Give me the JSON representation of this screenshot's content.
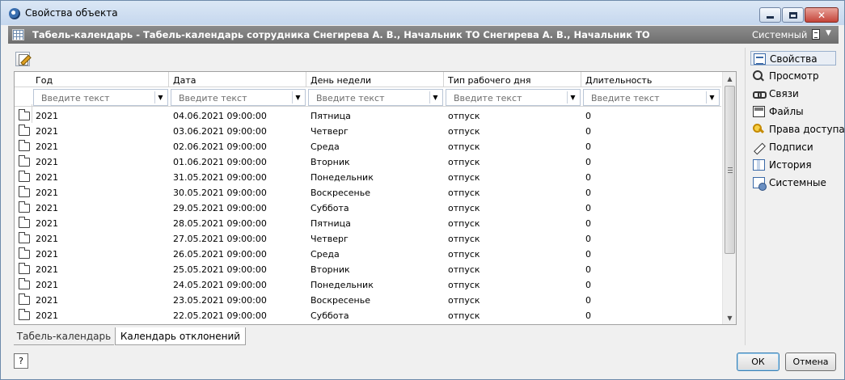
{
  "window": {
    "title": "Свойства объекта",
    "minimize_glyph": "",
    "close_glyph": "✕"
  },
  "object_bar": {
    "title": "Табель-календарь - Табель-календарь сотрудника Снегирева А. В., Начальник ТО Снегирева А. В., Начальник ТО",
    "system_label": "Системный",
    "dropdown_glyph": "▼"
  },
  "grid": {
    "columns": [
      "Год",
      "Дата",
      "День недели",
      "Тип рабочего дня",
      "Длительность"
    ],
    "filter_placeholder": "Введите текст",
    "rows": [
      {
        "year": "2021",
        "date": "04.06.2021 09:00:00",
        "weekday": "Пятница",
        "type": "отпуск",
        "duration": "0"
      },
      {
        "year": "2021",
        "date": "03.06.2021 09:00:00",
        "weekday": "Четверг",
        "type": "отпуск",
        "duration": "0"
      },
      {
        "year": "2021",
        "date": "02.06.2021 09:00:00",
        "weekday": "Среда",
        "type": "отпуск",
        "duration": "0"
      },
      {
        "year": "2021",
        "date": "01.06.2021 09:00:00",
        "weekday": "Вторник",
        "type": "отпуск",
        "duration": "0"
      },
      {
        "year": "2021",
        "date": "31.05.2021 09:00:00",
        "weekday": "Понедельник",
        "type": "отпуск",
        "duration": "0"
      },
      {
        "year": "2021",
        "date": "30.05.2021 09:00:00",
        "weekday": "Воскресенье",
        "type": "отпуск",
        "duration": "0"
      },
      {
        "year": "2021",
        "date": "29.05.2021 09:00:00",
        "weekday": "Суббота",
        "type": "отпуск",
        "duration": "0"
      },
      {
        "year": "2021",
        "date": "28.05.2021 09:00:00",
        "weekday": "Пятница",
        "type": "отпуск",
        "duration": "0"
      },
      {
        "year": "2021",
        "date": "27.05.2021 09:00:00",
        "weekday": "Четверг",
        "type": "отпуск",
        "duration": "0"
      },
      {
        "year": "2021",
        "date": "26.05.2021 09:00:00",
        "weekday": "Среда",
        "type": "отпуск",
        "duration": "0"
      },
      {
        "year": "2021",
        "date": "25.05.2021 09:00:00",
        "weekday": "Вторник",
        "type": "отпуск",
        "duration": "0"
      },
      {
        "year": "2021",
        "date": "24.05.2021 09:00:00",
        "weekday": "Понедельник",
        "type": "отпуск",
        "duration": "0"
      },
      {
        "year": "2021",
        "date": "23.05.2021 09:00:00",
        "weekday": "Воскресенье",
        "type": "отпуск",
        "duration": "0"
      },
      {
        "year": "2021",
        "date": "22.05.2021 09:00:00",
        "weekday": "Суббота",
        "type": "отпуск",
        "duration": "0"
      }
    ]
  },
  "tabs": [
    "Табель-календарь",
    "Календарь отклонений"
  ],
  "active_tab": 1,
  "side_panel": {
    "items": [
      {
        "label": "Свойства",
        "icon": "properties-icon",
        "active": true
      },
      {
        "label": "Просмотр",
        "icon": "magnifier-icon"
      },
      {
        "label": "Связи",
        "icon": "chain-link-icon"
      },
      {
        "label": "Файлы",
        "icon": "floppy-disk-icon"
      },
      {
        "label": "Права доступа",
        "icon": "key-icon"
      },
      {
        "label": "Подписи",
        "icon": "pen-icon"
      },
      {
        "label": "История",
        "icon": "history-icon"
      },
      {
        "label": "Системные",
        "icon": "system-gear-icon"
      }
    ]
  },
  "footer": {
    "help_label": "?",
    "ok_label": "ОК",
    "cancel_label": "Отмена"
  },
  "colors": {
    "object_bar": "#7d7d7d",
    "window_bg": "#f0f0f0",
    "active_side_item": "#e9eef5"
  }
}
